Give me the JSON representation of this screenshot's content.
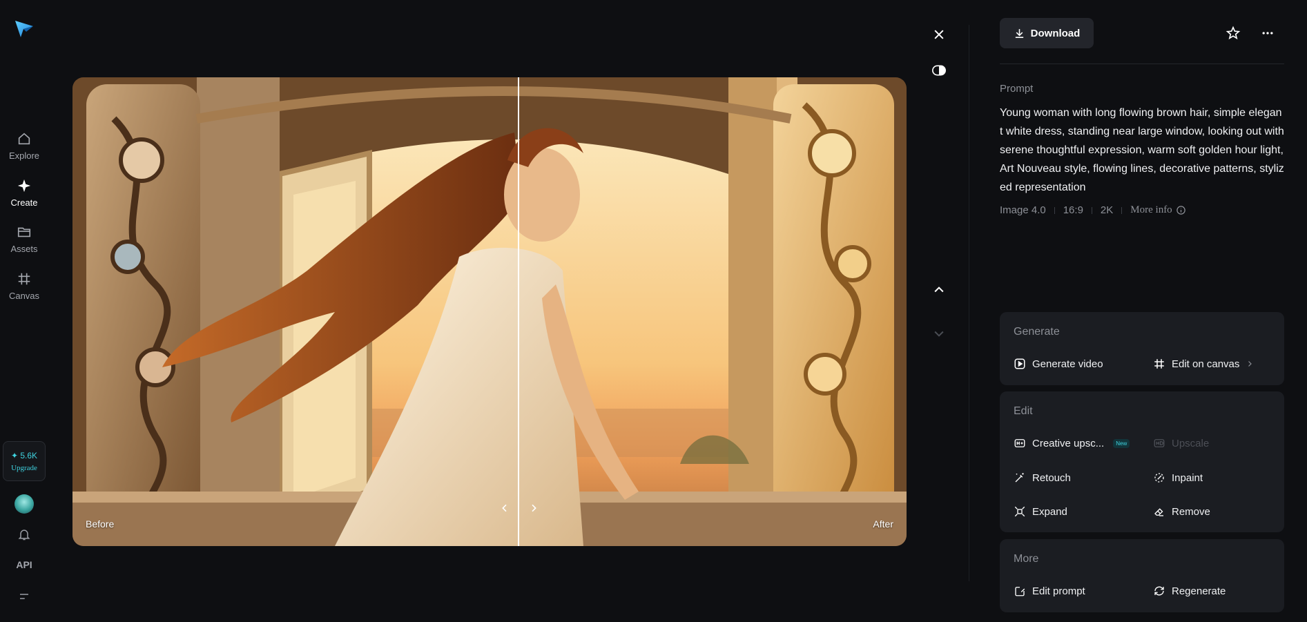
{
  "sidebar": {
    "logo": "paper-plane-logo-icon",
    "items": [
      {
        "label": "Explore",
        "icon": "home-icon"
      },
      {
        "label": "Create",
        "icon": "sparkle-icon"
      },
      {
        "label": "Assets",
        "icon": "folder-icon"
      },
      {
        "label": "Canvas",
        "icon": "canvas-icon"
      }
    ],
    "credits": "✦ 5.6K",
    "upgrade_label": "Upgrade",
    "api_label": "API"
  },
  "viewer": {
    "before_label": "Before",
    "after_label": "After",
    "split_fraction": 0.535
  },
  "panel": {
    "download_label": "Download",
    "prompt_title": "Prompt",
    "prompt_text": "Young woman with long flowing brown hair, simple elegant white dress, standing near large window, looking out with serene thoughtful expression, warm soft golden hour light, Art Nouveau style, flowing lines, decorative patterns, stylized representation",
    "meta": {
      "model": "Image 4.0",
      "ratio": "16:9",
      "resolution": "2K",
      "more_info": "More info"
    },
    "generate": {
      "title": "Generate",
      "generate_video": "Generate video",
      "edit_on_canvas": "Edit on canvas"
    },
    "edit": {
      "title": "Edit",
      "creative_upscale": "Creative upsc...",
      "new_badge": "New",
      "upscale": "Upscale",
      "retouch": "Retouch",
      "inpaint": "Inpaint",
      "expand": "Expand",
      "remove": "Remove"
    },
    "more": {
      "title": "More",
      "edit_prompt": "Edit prompt",
      "regenerate": "Regenerate"
    }
  },
  "colors": {
    "background": "#0e0f12",
    "card": "#1b1d22",
    "accent": "#3fd3e0"
  }
}
